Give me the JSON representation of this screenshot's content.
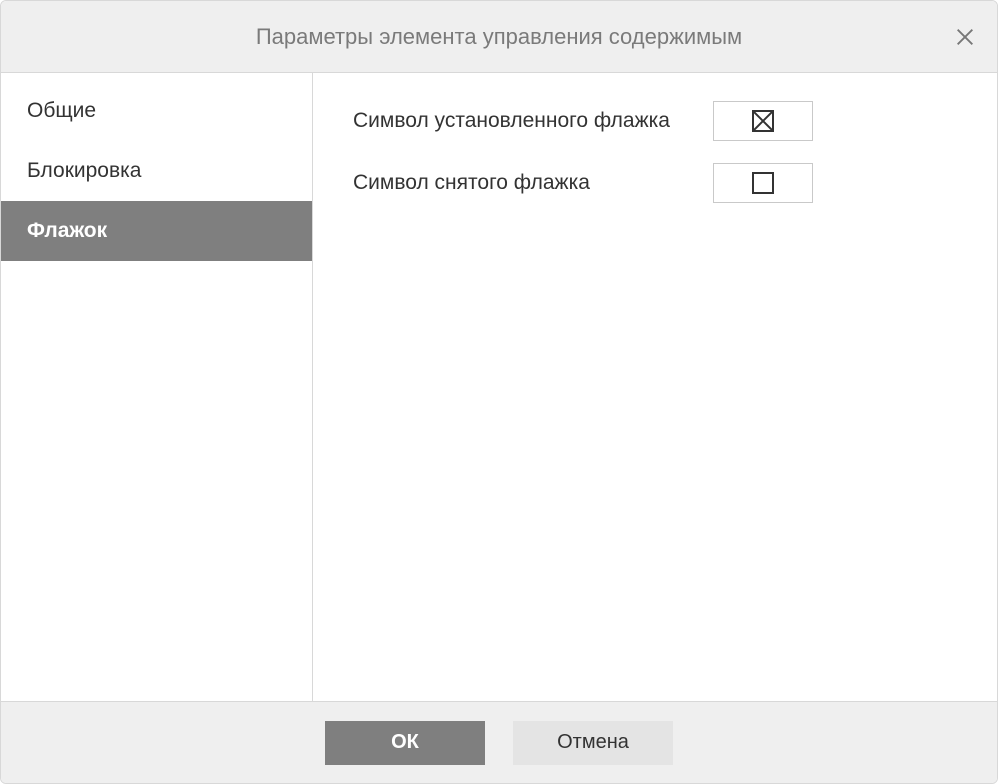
{
  "title": "Параметры элемента управления содержимым",
  "sidebar": {
    "items": [
      {
        "label": "Общие",
        "active": false
      },
      {
        "label": "Блокировка",
        "active": false
      },
      {
        "label": "Флажок",
        "active": true
      }
    ]
  },
  "content": {
    "checked_symbol_label": "Символ установленного флажка",
    "unchecked_symbol_label": "Символ снятого флажка",
    "checked_symbol_glyph": "boxed-x",
    "unchecked_symbol_glyph": "empty-box"
  },
  "footer": {
    "ok_label": "ОК",
    "cancel_label": "Отмена"
  }
}
